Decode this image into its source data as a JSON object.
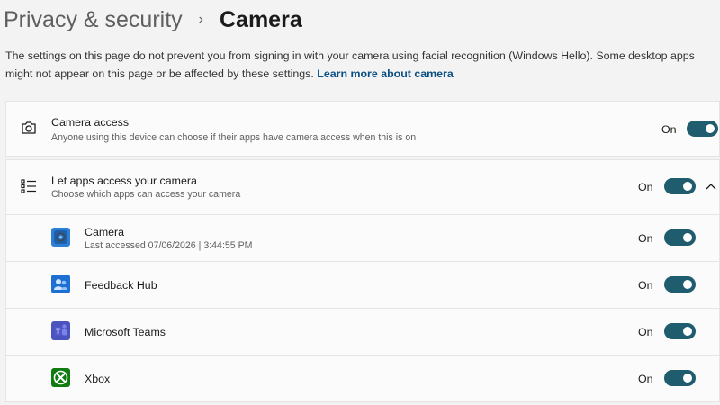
{
  "breadcrumb": {
    "parent": "Privacy & security",
    "separator": "›",
    "current": "Camera"
  },
  "description": {
    "text": "The settings on this page do not prevent you from signing in with your camera using facial recognition (Windows Hello). Some desktop apps might not appear on this page or be affected by these settings.",
    "link": "Learn more about camera"
  },
  "camera_access": {
    "title": "Camera access",
    "subtitle": "Anyone using this device can choose if their apps have camera access when this is on",
    "state": "On",
    "enabled": true,
    "icon": "camera-icon"
  },
  "let_apps": {
    "title": "Let apps access your camera",
    "subtitle": "Choose which apps can access your camera",
    "state": "On",
    "enabled": true,
    "icon": "list-icon",
    "expand_icon": "chevron-up-icon"
  },
  "apps": [
    {
      "name": "Camera",
      "detail": "Last accessed 07/06/2026  |  3:44:55 PM",
      "state": "On",
      "enabled": true,
      "icon": "camera-app-icon"
    },
    {
      "name": "Feedback Hub",
      "state": "On",
      "enabled": true,
      "icon": "feedback-hub-icon"
    },
    {
      "name": "Microsoft Teams",
      "state": "On",
      "enabled": true,
      "icon": "teams-icon"
    },
    {
      "name": "Xbox",
      "state": "On",
      "enabled": true,
      "icon": "xbox-icon"
    }
  ],
  "colors": {
    "toggle_on": "#1e5c6e",
    "link": "#0b4f83",
    "background": "#f3f3f3",
    "card": "#fbfbfb"
  }
}
